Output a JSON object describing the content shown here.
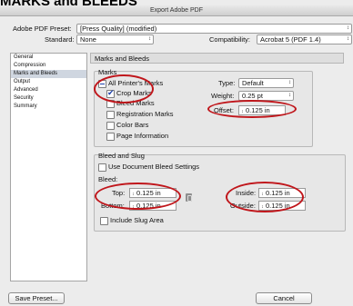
{
  "heading": "MARKS and BLEEDS",
  "window": {
    "title": "Export Adobe PDF"
  },
  "preset": {
    "label": "Adobe PDF Preset:",
    "value": "[Press Quality] (modified)"
  },
  "standard": {
    "label": "Standard:",
    "value": "None"
  },
  "compatibility": {
    "label": "Compatibility:",
    "value": "Acrobat 5 (PDF 1.4)"
  },
  "sidebar": {
    "items": [
      {
        "label": "General"
      },
      {
        "label": "Compression"
      },
      {
        "label": "Marks and Bleeds"
      },
      {
        "label": "Output"
      },
      {
        "label": "Advanced"
      },
      {
        "label": "Security"
      },
      {
        "label": "Summary"
      }
    ],
    "selected": "Marks and Bleeds"
  },
  "panel": {
    "title": "Marks and Bleeds"
  },
  "marks": {
    "title": "Marks",
    "all_printers": "All Printer's Marks",
    "crop": "Crop Marks",
    "bleed_marks": "Bleed Marks",
    "registration": "Registration Marks",
    "color_bars": "Color Bars",
    "page_info": "Page Information",
    "type_label": "Type:",
    "type_value": "Default",
    "weight_label": "Weight:",
    "weight_value": "0.25 pt",
    "offset_label": "Offset:",
    "offset_value": "0.125 in"
  },
  "bleed": {
    "title": "Bleed and Slug",
    "use_doc": "Use Document Bleed Settings",
    "bleed_label": "Bleed:",
    "top_label": "Top:",
    "top_value": "0.125 in",
    "bottom_label": "Bottom:",
    "bottom_value": "0.125 in",
    "inside_label": "Inside:",
    "inside_value": "0.125 in",
    "outside_label": "Outside:",
    "outside_value": "0.125 in",
    "include_slug": "Include Slug Area"
  },
  "buttons": {
    "save_preset": "Save Preset...",
    "cancel": "Cancel"
  },
  "icons": {
    "spin": "↕",
    "arrow": "↕",
    "check": "checkmark-icon",
    "chain": "chain-link-icon"
  },
  "colors": {
    "annotation": "#c0161b",
    "check": "#1b3fa8",
    "selection": "#cfd6e0"
  }
}
